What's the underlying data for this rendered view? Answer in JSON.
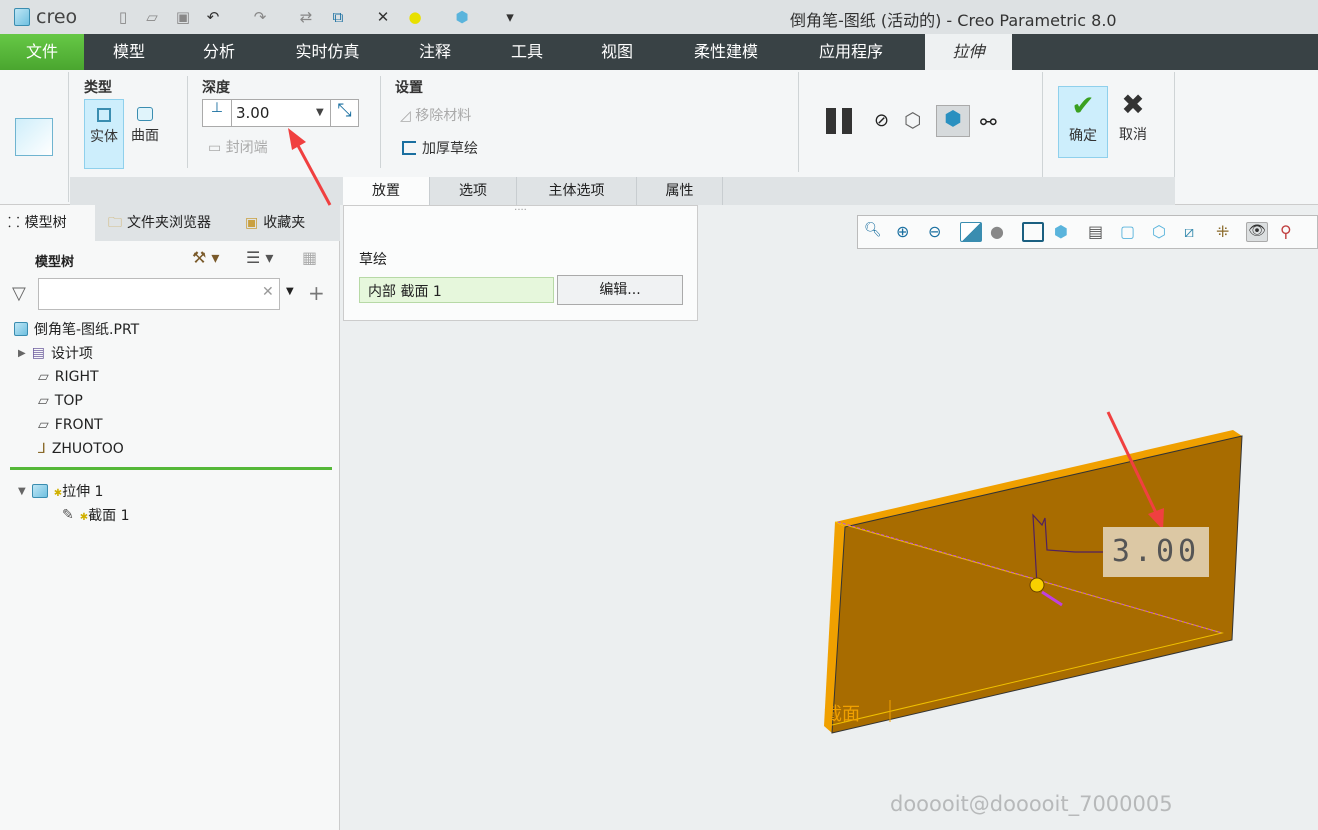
{
  "window": {
    "app": "creo",
    "title": "倒角笔-图纸 (活动的) - Creo Parametric 8.0"
  },
  "menu": [
    "文件",
    "模型",
    "分析",
    "实时仿真",
    "注释",
    "工具",
    "视图",
    "柔性建模",
    "应用程序",
    "拉伸"
  ],
  "ribbon": {
    "type": {
      "label": "类型",
      "solid": "实体",
      "surface": "曲面"
    },
    "depth": {
      "label": "深度",
      "value": "3.00",
      "cap": "封闭端"
    },
    "settings": {
      "label": "设置",
      "remove": "移除材料",
      "thicken": "加厚草绘"
    },
    "ok": "确定",
    "cancel": "取消",
    "tabs": [
      "放置",
      "选项",
      "主体选项",
      "属性"
    ]
  },
  "placement": {
    "label": "草绘",
    "value": "内部 截面 1",
    "edit": "编辑..."
  },
  "left": {
    "tabs": [
      "模型树",
      "文件夹浏览器",
      "收藏夹"
    ],
    "header": "模型树",
    "search_value": "",
    "items": [
      "倒角笔-图纸.PRT",
      "设计项",
      "RIGHT",
      "TOP",
      "FRONT",
      "ZHUOTOO"
    ],
    "feature": "拉伸 1",
    "section": "截面 1"
  },
  "viewport": {
    "dimension": "3.00",
    "section_label": "截面",
    "watermark": "dooooit@dooooit_7000005"
  },
  "colors": {
    "accent_green": "#55b838",
    "plate": "#a86c00",
    "edge": "#f0a000",
    "arrow": "#f04040"
  }
}
